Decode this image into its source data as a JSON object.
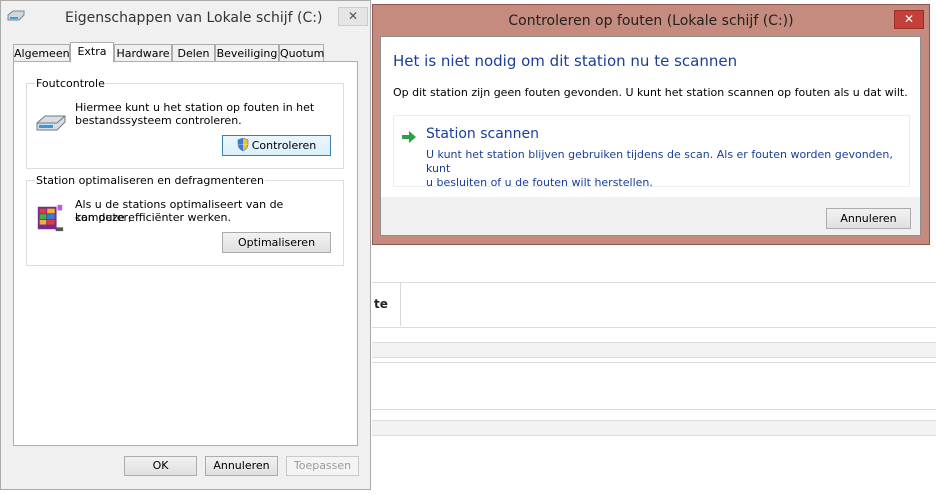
{
  "background": {
    "column_header": "te"
  },
  "properties": {
    "title": "Eigenschappen van Lokale schijf (C:)",
    "close_glyph": "✕",
    "tabs": [
      {
        "label": "Algemeen"
      },
      {
        "label": "Extra"
      },
      {
        "label": "Hardware"
      },
      {
        "label": "Delen"
      },
      {
        "label": "Beveiliging"
      },
      {
        "label": "Quotum"
      }
    ],
    "active_tab": "Extra",
    "error_check": {
      "group_label": "Foutcontrole",
      "line1": "Hiermee kunt u het station op fouten in het",
      "line2": "bestandssysteem controleren.",
      "button": "Controleren"
    },
    "optimize": {
      "group_label": "Station optimaliseren en defragmenteren",
      "line1": "Als u de stations optimaliseert van de computer,",
      "line2": "kan deze efficiënter werken.",
      "button": "Optimaliseren"
    },
    "footer": {
      "ok": "OK",
      "cancel": "Annuleren",
      "apply": "Toepassen"
    }
  },
  "scan_dialog": {
    "title": "Controleren op fouten (Lokale schijf (C:))",
    "close_glyph": "✕",
    "heading": "Het is niet nodig om dit station nu te scannen",
    "description": "Op dit station zijn geen fouten gevonden. U kunt het station scannen op fouten als u dat wilt.",
    "option_title": "Station scannen",
    "option_desc_line1": "U kunt het station blijven gebruiken tijdens de scan. Als er fouten worden gevonden, kunt",
    "option_desc_line2": "u besluiten of u de fouten wilt herstellen.",
    "cancel": "Annuleren"
  },
  "colors": {
    "accent_blue": "#1a3e9a",
    "scan_frame": "#c58b7e",
    "close_red": "#c4403a"
  }
}
